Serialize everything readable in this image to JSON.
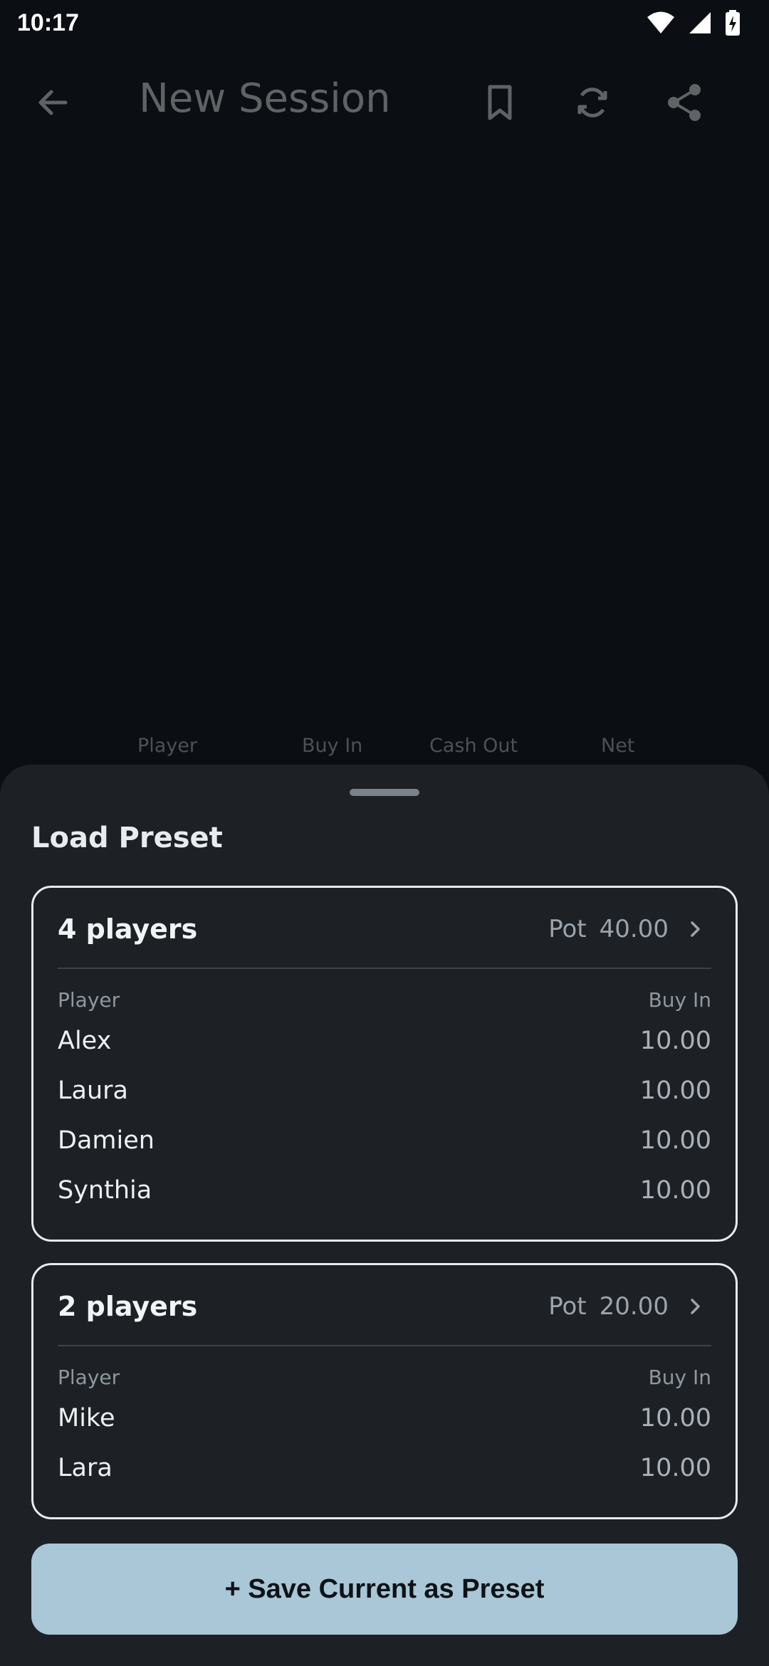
{
  "status_bar": {
    "time": "10:17",
    "icons": [
      "wifi-icon",
      "signal-icon",
      "battery-charging-icon"
    ]
  },
  "app_bar": {
    "title": "New Session",
    "actions": [
      "bookmark-icon",
      "refresh-icon",
      "share-icon"
    ]
  },
  "table_headers": {
    "player": "Player",
    "buy_in": "Buy In",
    "cash_out": "Cash Out",
    "net": "Net"
  },
  "sheet": {
    "title": "Load Preset",
    "presets": [
      {
        "players_label": "4 players",
        "pot_label": "Pot",
        "pot_value": "40.00",
        "col_player": "Player",
        "col_buy_in": "Buy In",
        "rows": [
          {
            "name": "Alex",
            "buy_in": "10.00"
          },
          {
            "name": "Laura",
            "buy_in": "10.00"
          },
          {
            "name": "Damien",
            "buy_in": "10.00"
          },
          {
            "name": "Synthia",
            "buy_in": "10.00"
          }
        ]
      },
      {
        "players_label": "2 players",
        "pot_label": "Pot",
        "pot_value": "20.00",
        "col_player": "Player",
        "col_buy_in": "Buy In",
        "rows": [
          {
            "name": "Mike",
            "buy_in": "10.00"
          },
          {
            "name": "Lara",
            "buy_in": "10.00"
          }
        ]
      }
    ],
    "save_button": "+ Save Current as Preset"
  },
  "colors": {
    "background": "#0b0e12",
    "sheet": "#1d2126",
    "accent_button": "#a9c7d6"
  }
}
